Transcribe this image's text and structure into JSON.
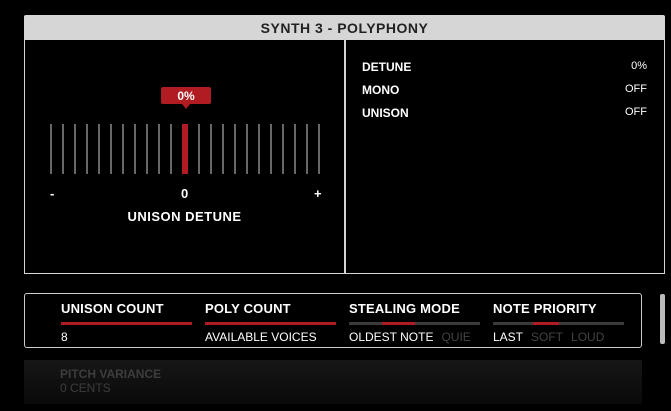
{
  "panel": {
    "title": "SYNTH 3 - POLYPHONY"
  },
  "detune_control": {
    "value_display": "0%",
    "minus_label": "-",
    "center_label": "0",
    "plus_label": "+",
    "caption": "UNISON DETUNE"
  },
  "params": [
    {
      "name": "DETUNE",
      "value": "0%"
    },
    {
      "name": "MONO",
      "value": "OFF"
    },
    {
      "name": "UNISON",
      "value": "OFF"
    }
  ],
  "tabs": {
    "unison_count": {
      "title": "UNISON COUNT",
      "value": "8"
    },
    "poly_count": {
      "title": "POLY COUNT",
      "value": "AVAILABLE VOICES"
    },
    "stealing_mode": {
      "title": "STEALING MODE",
      "options": [
        "OLDEST NOTE",
        "QUIE"
      ]
    },
    "note_priority": {
      "title": "NOTE PRIORITY",
      "options": [
        "LAST",
        "SOFT",
        "LOUD"
      ]
    }
  },
  "pitch_variance": {
    "title": "PITCH VARIANCE",
    "value": "0 CENTS"
  },
  "colors": {
    "accent": "#b01c22",
    "panel_header": "#d6d6d6",
    "background": "#000000"
  }
}
